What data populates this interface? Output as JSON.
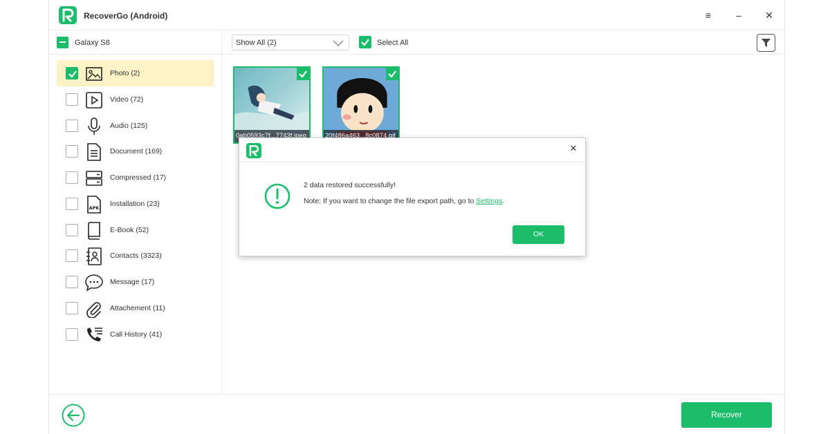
{
  "app": {
    "title": "RecoverGo (Android)",
    "accent_color": "#1cbd6a"
  },
  "window_controls": [
    {
      "name": "menu-icon",
      "glyph": "≡"
    },
    {
      "name": "minimize-icon",
      "glyph": "–"
    },
    {
      "name": "close-icon",
      "glyph": "✕"
    }
  ],
  "device": {
    "name": "Galaxy S8"
  },
  "toolbar": {
    "filter_select": "Show All (2)",
    "select_all_label": "Select All",
    "select_all_checked": true
  },
  "categories": [
    {
      "label": "Photo  (2)",
      "icon": "photo-icon",
      "checked": true,
      "active": true
    },
    {
      "label": "Video  (72)",
      "icon": "video-icon",
      "checked": false
    },
    {
      "label": "Audio  (125)",
      "icon": "microphone-icon",
      "checked": false
    },
    {
      "label": "Document  (169)",
      "icon": "document-icon",
      "checked": false
    },
    {
      "label": "Compressed  (17)",
      "icon": "compressed-icon",
      "checked": false
    },
    {
      "label": "Installation  (23)",
      "icon": "apk-icon",
      "checked": false
    },
    {
      "label": "E-Book  (52)",
      "icon": "book-icon",
      "checked": false
    },
    {
      "label": "Contacts  (3323)",
      "icon": "contacts-icon",
      "checked": false
    },
    {
      "label": "Message  (17)",
      "icon": "message-icon",
      "checked": false
    },
    {
      "label": "Attachement  (11)",
      "icon": "paperclip-icon",
      "checked": false
    },
    {
      "label": "Call History  (41)",
      "icon": "call-history-icon",
      "checked": false
    }
  ],
  "files": [
    {
      "caption": "0ab0593c7f...7743f.jpeg",
      "checked": true
    },
    {
      "caption": "20f486a463...8c0874.gif",
      "checked": true
    }
  ],
  "dialog": {
    "message": "2 data restored successfully!",
    "note_prefix": "Note: If you want to change the file export path, go to ",
    "note_link": "Settings",
    "note_suffix": ".",
    "ok_label": "OK",
    "close_glyph": "✕"
  },
  "footer": {
    "recover_label": "Recover"
  }
}
